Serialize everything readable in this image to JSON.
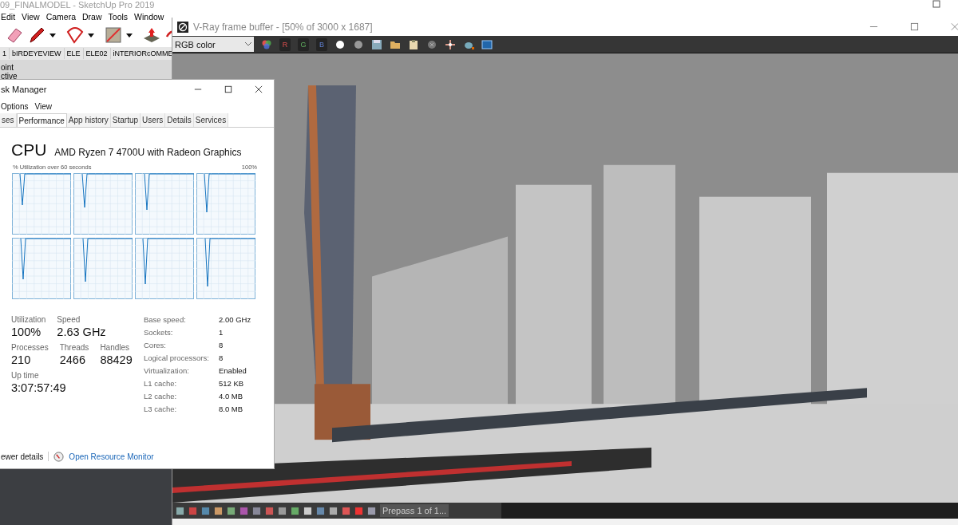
{
  "sketchup": {
    "title": "09_FINALMODEL - SketchUp Pro 2019",
    "menu": [
      "Edit",
      "View",
      "Camera",
      "Draw",
      "Tools",
      "Window"
    ],
    "scenes": [
      "1",
      "bIRDEYEVIEW",
      "ELE",
      "ELE02",
      "iNTERIORcOMME"
    ],
    "panel_lines": [
      "oint",
      "ctive"
    ]
  },
  "task_manager": {
    "title": "sk Manager",
    "menu": [
      "Options",
      "View"
    ],
    "tabs": [
      {
        "label": "ses",
        "selected": false
      },
      {
        "label": "Performance",
        "selected": true
      },
      {
        "label": "App history",
        "selected": false
      },
      {
        "label": "Startup",
        "selected": false
      },
      {
        "label": "Users",
        "selected": false
      },
      {
        "label": "Details",
        "selected": false
      },
      {
        "label": "Services",
        "selected": false
      }
    ],
    "heading": "CPU",
    "model": "AMD Ryzen 7 4700U with Radeon Graphics",
    "graph_caption": "% Utilization over 60 seconds",
    "graph_max": "100%",
    "stat_rows": [
      [
        {
          "label": "Utilization",
          "value": "100%"
        },
        {
          "label": "Speed",
          "value": "2.63 GHz"
        }
      ],
      [
        {
          "label": "Processes",
          "value": "210"
        },
        {
          "label": "Threads",
          "value": "2466"
        },
        {
          "label": "Handles",
          "value": "88429"
        }
      ],
      [
        {
          "label": "Up time",
          "value": "3:07:57:49"
        }
      ]
    ],
    "specs": [
      {
        "label": "Base speed:",
        "value": "2.00 GHz"
      },
      {
        "label": "Sockets:",
        "value": "1"
      },
      {
        "label": "Cores:",
        "value": "8"
      },
      {
        "label": "Logical processors:",
        "value": "8"
      },
      {
        "label": "Virtualization:",
        "value": "Enabled"
      },
      {
        "label": "L1 cache:",
        "value": "512 KB"
      },
      {
        "label": "L2 cache:",
        "value": "4.0 MB"
      },
      {
        "label": "L3 cache:",
        "value": "8.0 MB"
      }
    ],
    "fewer_details": "ewer details",
    "resource_monitor": "Open Resource Monitor"
  },
  "vray": {
    "title": "V-Ray frame buffer - [50% of 3000 x 1687]",
    "channel": "RGB color",
    "channel_buttons": [
      "R",
      "G",
      "B"
    ],
    "status": "Prepass 1 of 1..."
  }
}
